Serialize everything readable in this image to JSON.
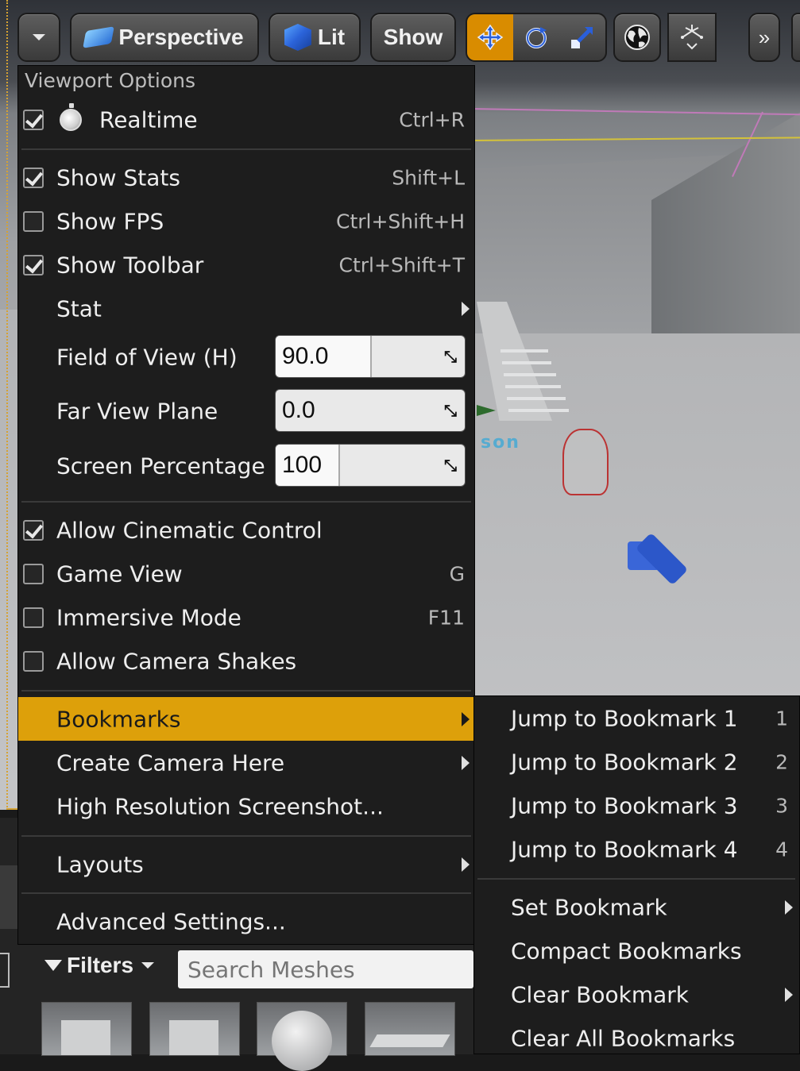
{
  "toolbar": {
    "options_label": "",
    "perspective_label": "Perspective",
    "lit_label": "Lit",
    "show_label": "Show",
    "overflow_glyph": "»",
    "accent_color": "#d98c00"
  },
  "scene": {
    "label_fragment": "son"
  },
  "menu": {
    "header": "Viewport Options",
    "realtime": {
      "label": "Realtime",
      "shortcut": "Ctrl+R",
      "checked": true
    },
    "show_stats": {
      "label": "Show Stats",
      "shortcut": "Shift+L",
      "checked": true
    },
    "show_fps": {
      "label": "Show FPS",
      "shortcut": "Ctrl+Shift+H",
      "checked": false
    },
    "show_toolbar": {
      "label": "Show Toolbar",
      "shortcut": "Ctrl+Shift+T",
      "checked": true
    },
    "stat": {
      "label": "Stat"
    },
    "fov": {
      "label": "Field of View (H)",
      "value": "90.0",
      "fill": 0.5
    },
    "far_plane": {
      "label": "Far View Plane",
      "value": "0.0",
      "fill": 0.0
    },
    "screen_pct": {
      "label": "Screen Percentage",
      "value": "100",
      "fill": 0.33
    },
    "cinematic": {
      "label": "Allow Cinematic Control",
      "checked": true
    },
    "game_view": {
      "label": "Game View",
      "shortcut": "G",
      "checked": false
    },
    "immersive": {
      "label": "Immersive Mode",
      "shortcut": "F11",
      "checked": false
    },
    "camera_shakes": {
      "label": "Allow Camera Shakes",
      "checked": false
    },
    "bookmarks": {
      "label": "Bookmarks"
    },
    "create_camera": {
      "label": "Create Camera Here"
    },
    "screenshot": {
      "label": "High Resolution Screenshot..."
    },
    "layouts": {
      "label": "Layouts"
    },
    "advanced": {
      "label": "Advanced Settings..."
    },
    "highlight_color": "#dda00a"
  },
  "submenu": {
    "jump1": {
      "label": "Jump to Bookmark 1",
      "shortcut": "1"
    },
    "jump2": {
      "label": "Jump to Bookmark 2",
      "shortcut": "2"
    },
    "jump3": {
      "label": "Jump to Bookmark 3",
      "shortcut": "3"
    },
    "jump4": {
      "label": "Jump to Bookmark 4",
      "shortcut": "4"
    },
    "set": {
      "label": "Set Bookmark"
    },
    "compact": {
      "label": "Compact Bookmarks"
    },
    "clear": {
      "label": "Clear Bookmark"
    },
    "clear_all": {
      "label": "Clear All Bookmarks"
    }
  },
  "content_browser": {
    "filters_label": "Filters",
    "search_placeholder": "Search Meshes"
  }
}
